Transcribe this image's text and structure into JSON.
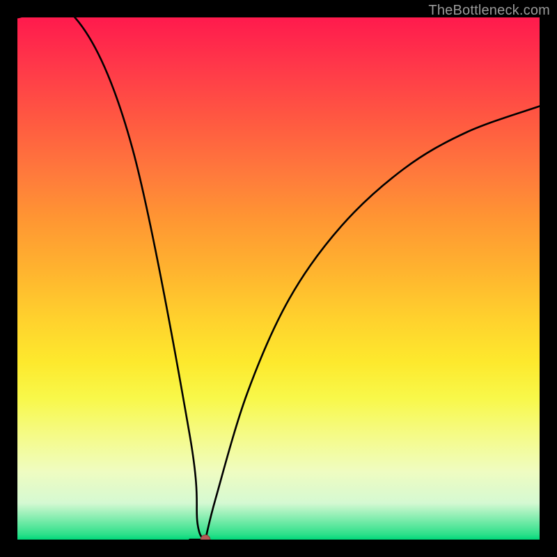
{
  "watermark": "TheBottleneck.com",
  "chart_data": {
    "type": "line",
    "title": "",
    "xlabel": "",
    "ylabel": "",
    "xlim": [
      0,
      100
    ],
    "ylim": [
      0,
      100
    ],
    "grid": false,
    "legend": false,
    "marker": {
      "x": 36,
      "y": 0,
      "color": "#b55a56"
    },
    "series": [
      {
        "name": "left-branch",
        "x": [
          0,
          11,
          22,
          33,
          34.5,
          36
        ],
        "y": [
          100,
          100,
          75,
          20,
          3,
          0
        ]
      },
      {
        "name": "valley-floor",
        "x": [
          33,
          36
        ],
        "y": [
          0,
          0
        ]
      },
      {
        "name": "right-branch",
        "x": [
          36,
          38,
          44,
          52,
          62,
          74,
          86,
          100
        ],
        "y": [
          0,
          8,
          28,
          46,
          60,
          71,
          78,
          83
        ]
      }
    ],
    "background_gradient": {
      "orientation": "vertical",
      "stops": [
        {
          "pos": 0.0,
          "color": "#ff1a4d"
        },
        {
          "pos": 0.3,
          "color": "#ff7a3c"
        },
        {
          "pos": 0.6,
          "color": "#ffd22d"
        },
        {
          "pos": 0.8,
          "color": "#f5fb87"
        },
        {
          "pos": 0.95,
          "color": "#d5f9d2"
        },
        {
          "pos": 1.0,
          "color": "#00d87a"
        }
      ]
    }
  }
}
